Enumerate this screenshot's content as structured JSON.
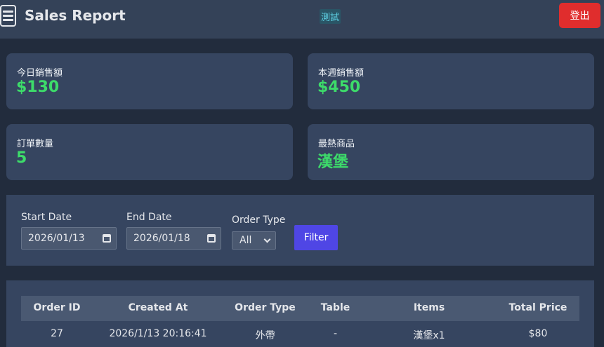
{
  "header": {
    "title": "Sales Report",
    "env_badge": "測試",
    "logout_label": "登出"
  },
  "stats": [
    {
      "label": "今日銷售額",
      "value": "$130"
    },
    {
      "label": "本週銷售額",
      "value": "$450"
    },
    {
      "label": "訂單數量",
      "value": "5"
    },
    {
      "label": "最熱商品",
      "value": "漢堡"
    }
  ],
  "filters": {
    "start_date_label": "Start Date",
    "start_date_value": "2026/01/13",
    "end_date_label": "End Date",
    "end_date_value": "2026/01/18",
    "order_type_label": "Order Type",
    "order_type_value": "All",
    "filter_button": "Filter"
  },
  "table": {
    "columns": [
      "Order ID",
      "Created At",
      "Order Type",
      "Table",
      "Items",
      "Total Price"
    ],
    "rows": [
      [
        "27",
        "2026/1/13 20:16:41",
        "外帶",
        "-",
        "漢堡x1",
        "$80"
      ]
    ]
  },
  "colors": {
    "accent_green": "#3ddc6a",
    "danger_red": "#e02d2d",
    "primary_indigo": "#4f46e5"
  },
  "icons": {
    "menu": "hamburger-menu-icon",
    "date": "calendar-icon",
    "select": "chevron-down-icon"
  }
}
